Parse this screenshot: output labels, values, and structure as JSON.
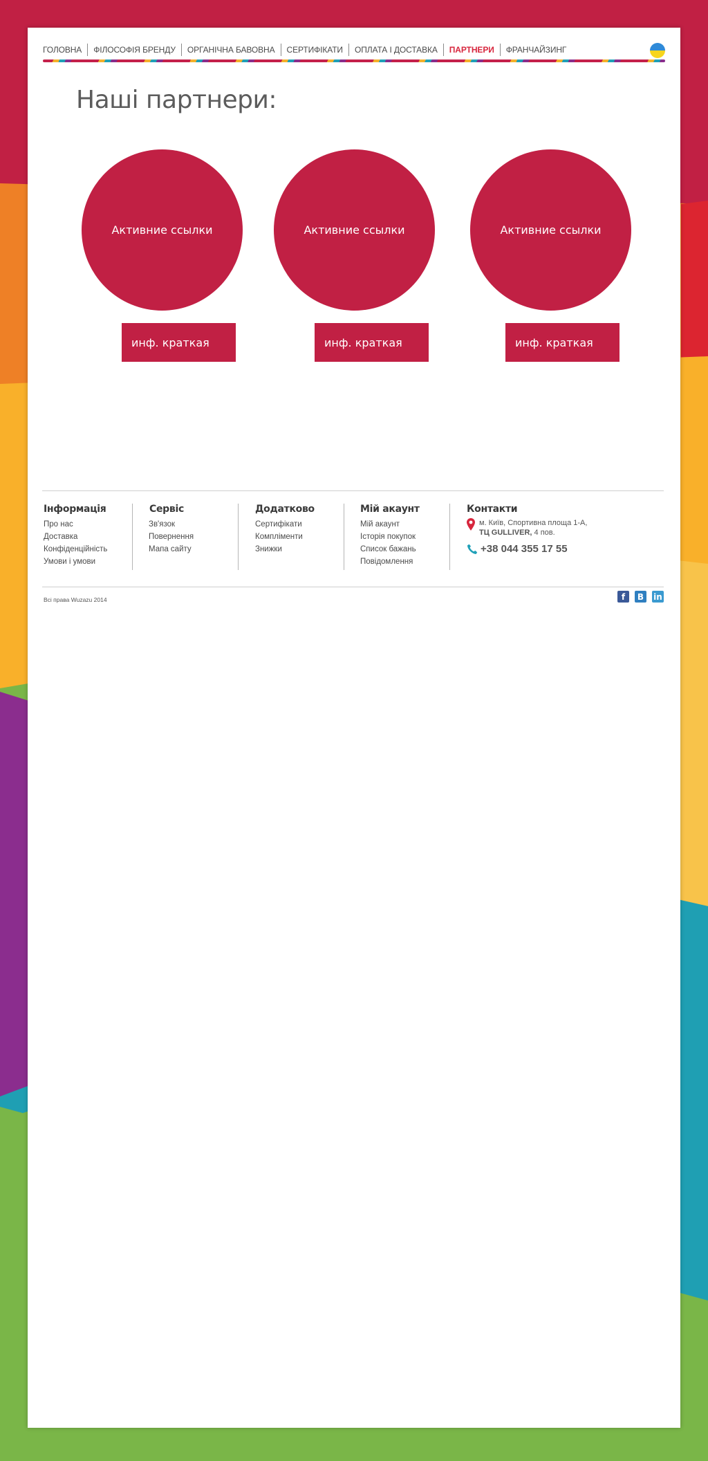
{
  "nav": {
    "items": [
      "ГОЛОВНА",
      "ФІЛОСОФІЯ БРЕНДУ",
      "ОРГАНІЧНА БАВОВНА",
      "СЕРТИФІКАТИ",
      "ОПЛАТА І ДОСТАВКА",
      "ПАРТНЕРИ",
      "ФРАНЧАЙЗИНГ"
    ],
    "active": "ПАРТНЕРИ"
  },
  "page_title": "Наші партнери:",
  "partners": [
    {
      "circle_label": "Активние ссылки",
      "info_label": "инф. краткая"
    },
    {
      "circle_label": "Активние ссылки",
      "info_label": "инф. краткая"
    },
    {
      "circle_label": "Активние ссылки",
      "info_label": "инф. краткая"
    }
  ],
  "footer": {
    "columns": [
      {
        "title": "Інформація",
        "links": [
          "Про нас",
          "Доставка",
          "Конфіденційність",
          "Умови і умови"
        ]
      },
      {
        "title": "Сервіс",
        "links": [
          "Зв'язок",
          "Повернення",
          "Мапа сайту"
        ]
      },
      {
        "title": "Додатково",
        "links": [
          "Сертифікати",
          "Компліменти",
          "Знижки"
        ]
      },
      {
        "title": "Мій акаунт",
        "links": [
          "Мій акаунт",
          "Історія покупок",
          "Список бажань",
          "Повідомлення"
        ]
      }
    ],
    "contacts": {
      "title": "Контакти",
      "address_line1": "м. Київ, Спортивна площа 1-А,",
      "address_line2_bold": "ТЦ GULLIVER,",
      "address_line2_rest": " 4 пов.",
      "phone": "+38 044 355 17 55"
    },
    "copyright": "Всі права Wuzazu 2014",
    "socials": [
      {
        "name": "facebook-icon",
        "glyph": "f",
        "color": "#3b5998"
      },
      {
        "name": "vk-icon",
        "glyph": "B",
        "color": "#2f7fc0"
      },
      {
        "name": "linkedin-icon",
        "glyph": "in",
        "color": "#3a9ad0"
      }
    ]
  },
  "colors": {
    "accent": "#c12044",
    "nav_active": "#d7263d",
    "flag_blue": "#2f8ad8",
    "flag_yellow": "#f7d51d",
    "phone_icon": "#1fa0b8",
    "pin_icon": "#d7263d"
  }
}
